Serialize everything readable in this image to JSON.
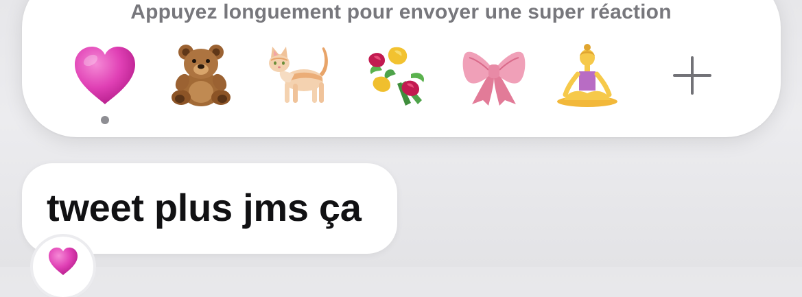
{
  "reaction_panel": {
    "hint": "Appuyez longuement pour envoyer une super réaction",
    "reactions": [
      {
        "icon": "heart-icon",
        "selected": true
      },
      {
        "icon": "teddy-bear-icon",
        "selected": false
      },
      {
        "icon": "cat-icon",
        "selected": false
      },
      {
        "icon": "bouquet-icon",
        "selected": false
      },
      {
        "icon": "ribbon-bow-icon",
        "selected": false
      },
      {
        "icon": "person-lotus-position-icon",
        "selected": false
      },
      {
        "icon": "plus-icon",
        "selected": false
      }
    ]
  },
  "message": {
    "text": "tweet plus jms ça",
    "tapback_icon": "heart-icon"
  },
  "colors": {
    "heart": "#e040b5",
    "bubble": "#ffffff",
    "background": "#e9e9ec",
    "hint_text": "#77777c",
    "message_text": "#111113"
  }
}
